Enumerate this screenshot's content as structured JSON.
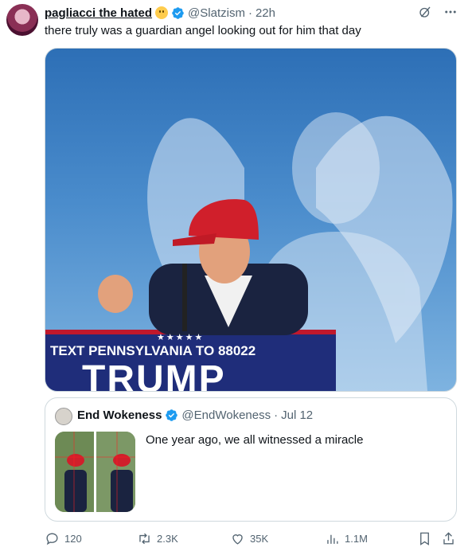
{
  "post": {
    "author_name": "pagliacci the hated",
    "handle": "@Slatzism",
    "separator": "·",
    "time": "22h",
    "text": "there truly was a guardian angel looking out for him that day"
  },
  "media": {
    "sign_text": "TEXT PENNSYLVANIA TO 88022",
    "sign_big": "TRUMP",
    "stars": "★★★★★"
  },
  "quote": {
    "author_name": "End Wokeness",
    "handle": "@EndWokeness",
    "separator": "·",
    "date": "Jul 12",
    "text": "One year ago, we all witnessed a miracle"
  },
  "actions": {
    "replies": "120",
    "reposts": "2.3K",
    "likes": "35K",
    "views": "1.1M"
  },
  "colors": {
    "accent": "#1d9bf0",
    "muted": "#536471",
    "text": "#0f1419",
    "border": "#cfd9de"
  }
}
